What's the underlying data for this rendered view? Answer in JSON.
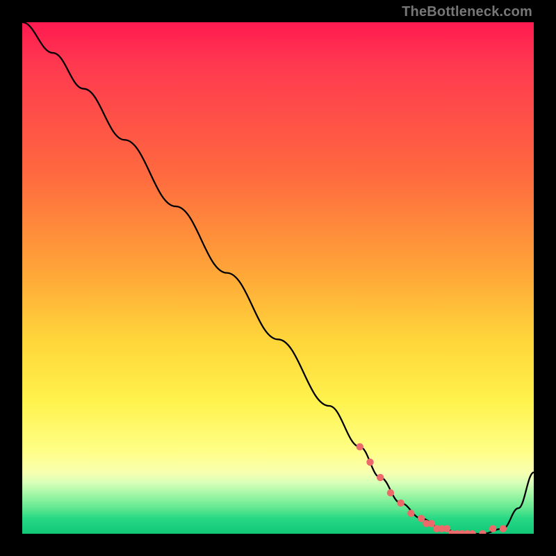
{
  "watermark": "TheBottleneck.com",
  "chart_data": {
    "type": "line",
    "title": "",
    "xlabel": "",
    "ylabel": "",
    "xlim": [
      0,
      100
    ],
    "ylim": [
      0,
      100
    ],
    "grid": false,
    "legend": false,
    "series": [
      {
        "name": "bottleneck-curve",
        "color": "#000000",
        "x": [
          0,
          6,
          12,
          20,
          30,
          40,
          50,
          60,
          66,
          70,
          74,
          78,
          82,
          86,
          90,
          94,
          97,
          100
        ],
        "y": [
          100,
          94,
          87,
          77,
          64,
          51,
          38,
          25,
          17,
          11,
          6,
          3,
          1,
          0,
          0,
          1,
          5,
          12
        ]
      }
    ],
    "markers": {
      "name": "highlight-dots",
      "color": "#ec6a6a",
      "x": [
        66,
        68,
        70,
        72,
        74,
        76,
        78,
        79,
        80,
        81,
        82,
        83,
        84,
        85,
        86,
        87,
        88,
        90,
        92,
        94
      ],
      "y": [
        17,
        14,
        11,
        8,
        6,
        4,
        3,
        2,
        2,
        1,
        1,
        1,
        0,
        0,
        0,
        0,
        0,
        0,
        1,
        1
      ]
    }
  }
}
